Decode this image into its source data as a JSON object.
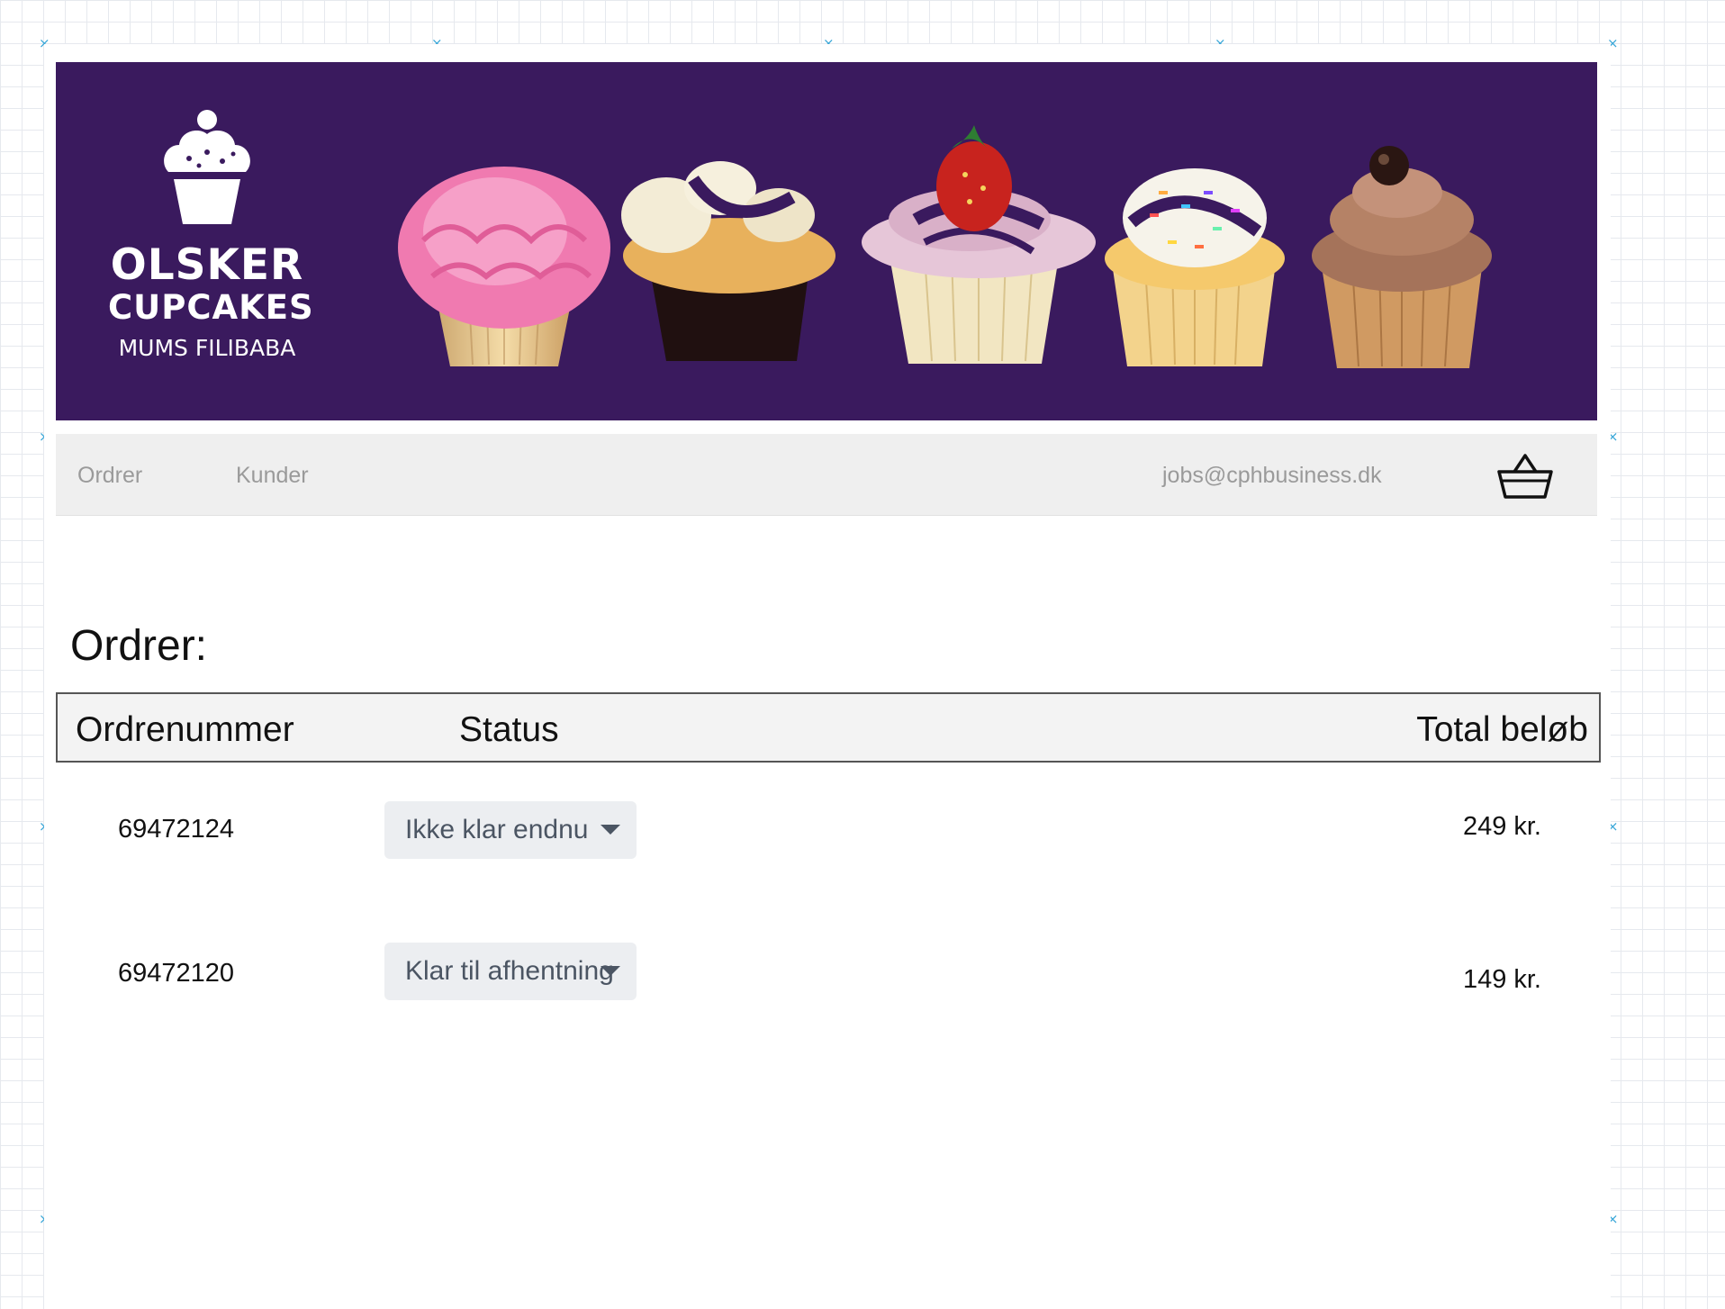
{
  "brand": {
    "line1": "OLSKER",
    "line2": "CUPCAKES",
    "line3": "MUMS FILIBABA"
  },
  "nav": {
    "items": [
      {
        "label": "Ordrer"
      },
      {
        "label": "Kunder"
      }
    ],
    "user_email": "jobs@cphbusiness.dk",
    "basket_icon": "basket-icon"
  },
  "page": {
    "title": "Ordrer:"
  },
  "table": {
    "headers": [
      "Ordrenummer",
      "Status",
      "Total beløb"
    ],
    "rows": [
      {
        "order_number": "69472124",
        "status": "Ikke klar endnu",
        "total": "249 kr."
      },
      {
        "order_number": "69472120",
        "status": "Klar til afhentning",
        "total": "149 kr."
      }
    ]
  },
  "colors": {
    "banner": "#3a1a5e",
    "navbar": "#efefef",
    "canvas_marker": "#38a6d8"
  }
}
